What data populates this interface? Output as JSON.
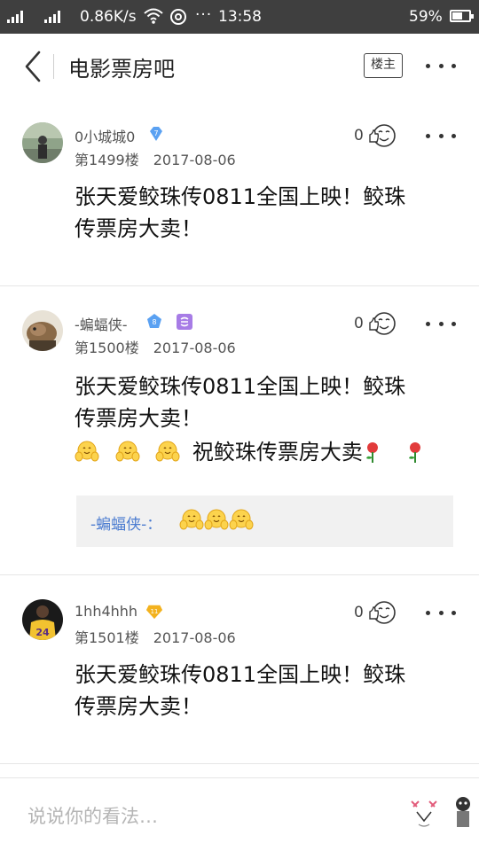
{
  "status_bar": {
    "speed": "0.86K/s",
    "time": "13:58",
    "battery": "59%",
    "battery_level": 0.59
  },
  "nav": {
    "title": "电影票房吧",
    "owner_filter_label": "楼主"
  },
  "posts": [
    {
      "username": "0小城城0",
      "level": "7",
      "floor": "第1499楼",
      "date": "2017-08-06",
      "likes": "0",
      "text_line1": "张天爱鲛珠传0811全国上映！鲛珠",
      "text_line2": "传票房大卖！"
    },
    {
      "username": "-蝙蝠侠-",
      "level": "8",
      "floor": "第1500楼",
      "date": "2017-08-06",
      "likes": "0",
      "text_line1": "张天爱鲛珠传0811全国上映！鲛珠",
      "text_line2": "传票房大卖！",
      "text_line3": "祝鲛珠传票房大卖",
      "reply_name": "-蝙蝠侠-："
    },
    {
      "username": "1hh4hhh",
      "level": "11",
      "floor": "第1501楼",
      "date": "2017-08-06",
      "likes": "0",
      "text_line1": "张天爱鲛珠传0811全国上映！鲛珠",
      "text_line2": "传票房大卖！"
    }
  ],
  "comment_bar": {
    "placeholder": "说说你的看法…"
  },
  "icons": {
    "back": "back-arrow-icon",
    "more": "more-dots-icon",
    "like": "thumb-up-face-icon",
    "level_badge": "diamond-level-icon",
    "member": "member-badge-icon",
    "emoji": "hug-emoji-icon",
    "rose": "rose-icon",
    "sticker": "sticker-icon"
  },
  "colors": {
    "status_bar_bg": "#3f3f3f",
    "level_blue": "#5aa1f2",
    "level_gold": "#f3b21e",
    "member_purple": "#a77ce6",
    "reply_name": "#4a7bd0",
    "placeholder": "#b5b5b5"
  }
}
